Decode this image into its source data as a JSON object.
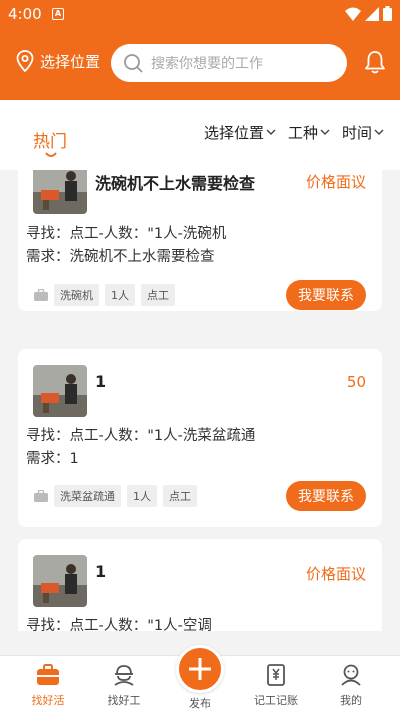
{
  "status": {
    "time": "4:00",
    "notification_glyph": "A"
  },
  "header": {
    "location_label": "选择位置",
    "search_placeholder": "搜索你想要的工作"
  },
  "filters": {
    "hot_tab": "热门",
    "items": [
      "选择位置",
      "工种",
      "时间"
    ]
  },
  "jobs": [
    {
      "title": "洗碗机不上水需要检查",
      "price": "价格面议",
      "seek": "寻找：点工-人数：\"1人-洗碗机",
      "need": "需求：洗碗机不上水需要检查",
      "tags": [
        "洗碗机",
        "1人",
        "点工"
      ],
      "contact": "我要联系"
    },
    {
      "title": "1",
      "price": "50",
      "seek": "寻找：点工-人数：\"1人-洗菜盆疏通",
      "need": "需求：1",
      "tags": [
        "洗菜盆疏通",
        "1人",
        "点工"
      ],
      "contact": "我要联系"
    },
    {
      "title": "1",
      "price": "价格面议",
      "seek": "寻找：点工-人数：\"1人-空调",
      "need": "",
      "tags": [],
      "contact": ""
    }
  ],
  "tabbar": {
    "items": [
      "找好活",
      "找好工",
      "发布",
      "记工记账",
      "我的"
    ],
    "active_index": 0
  },
  "colors": {
    "accent": "#f06c1a",
    "background": "#f3f3f3"
  }
}
